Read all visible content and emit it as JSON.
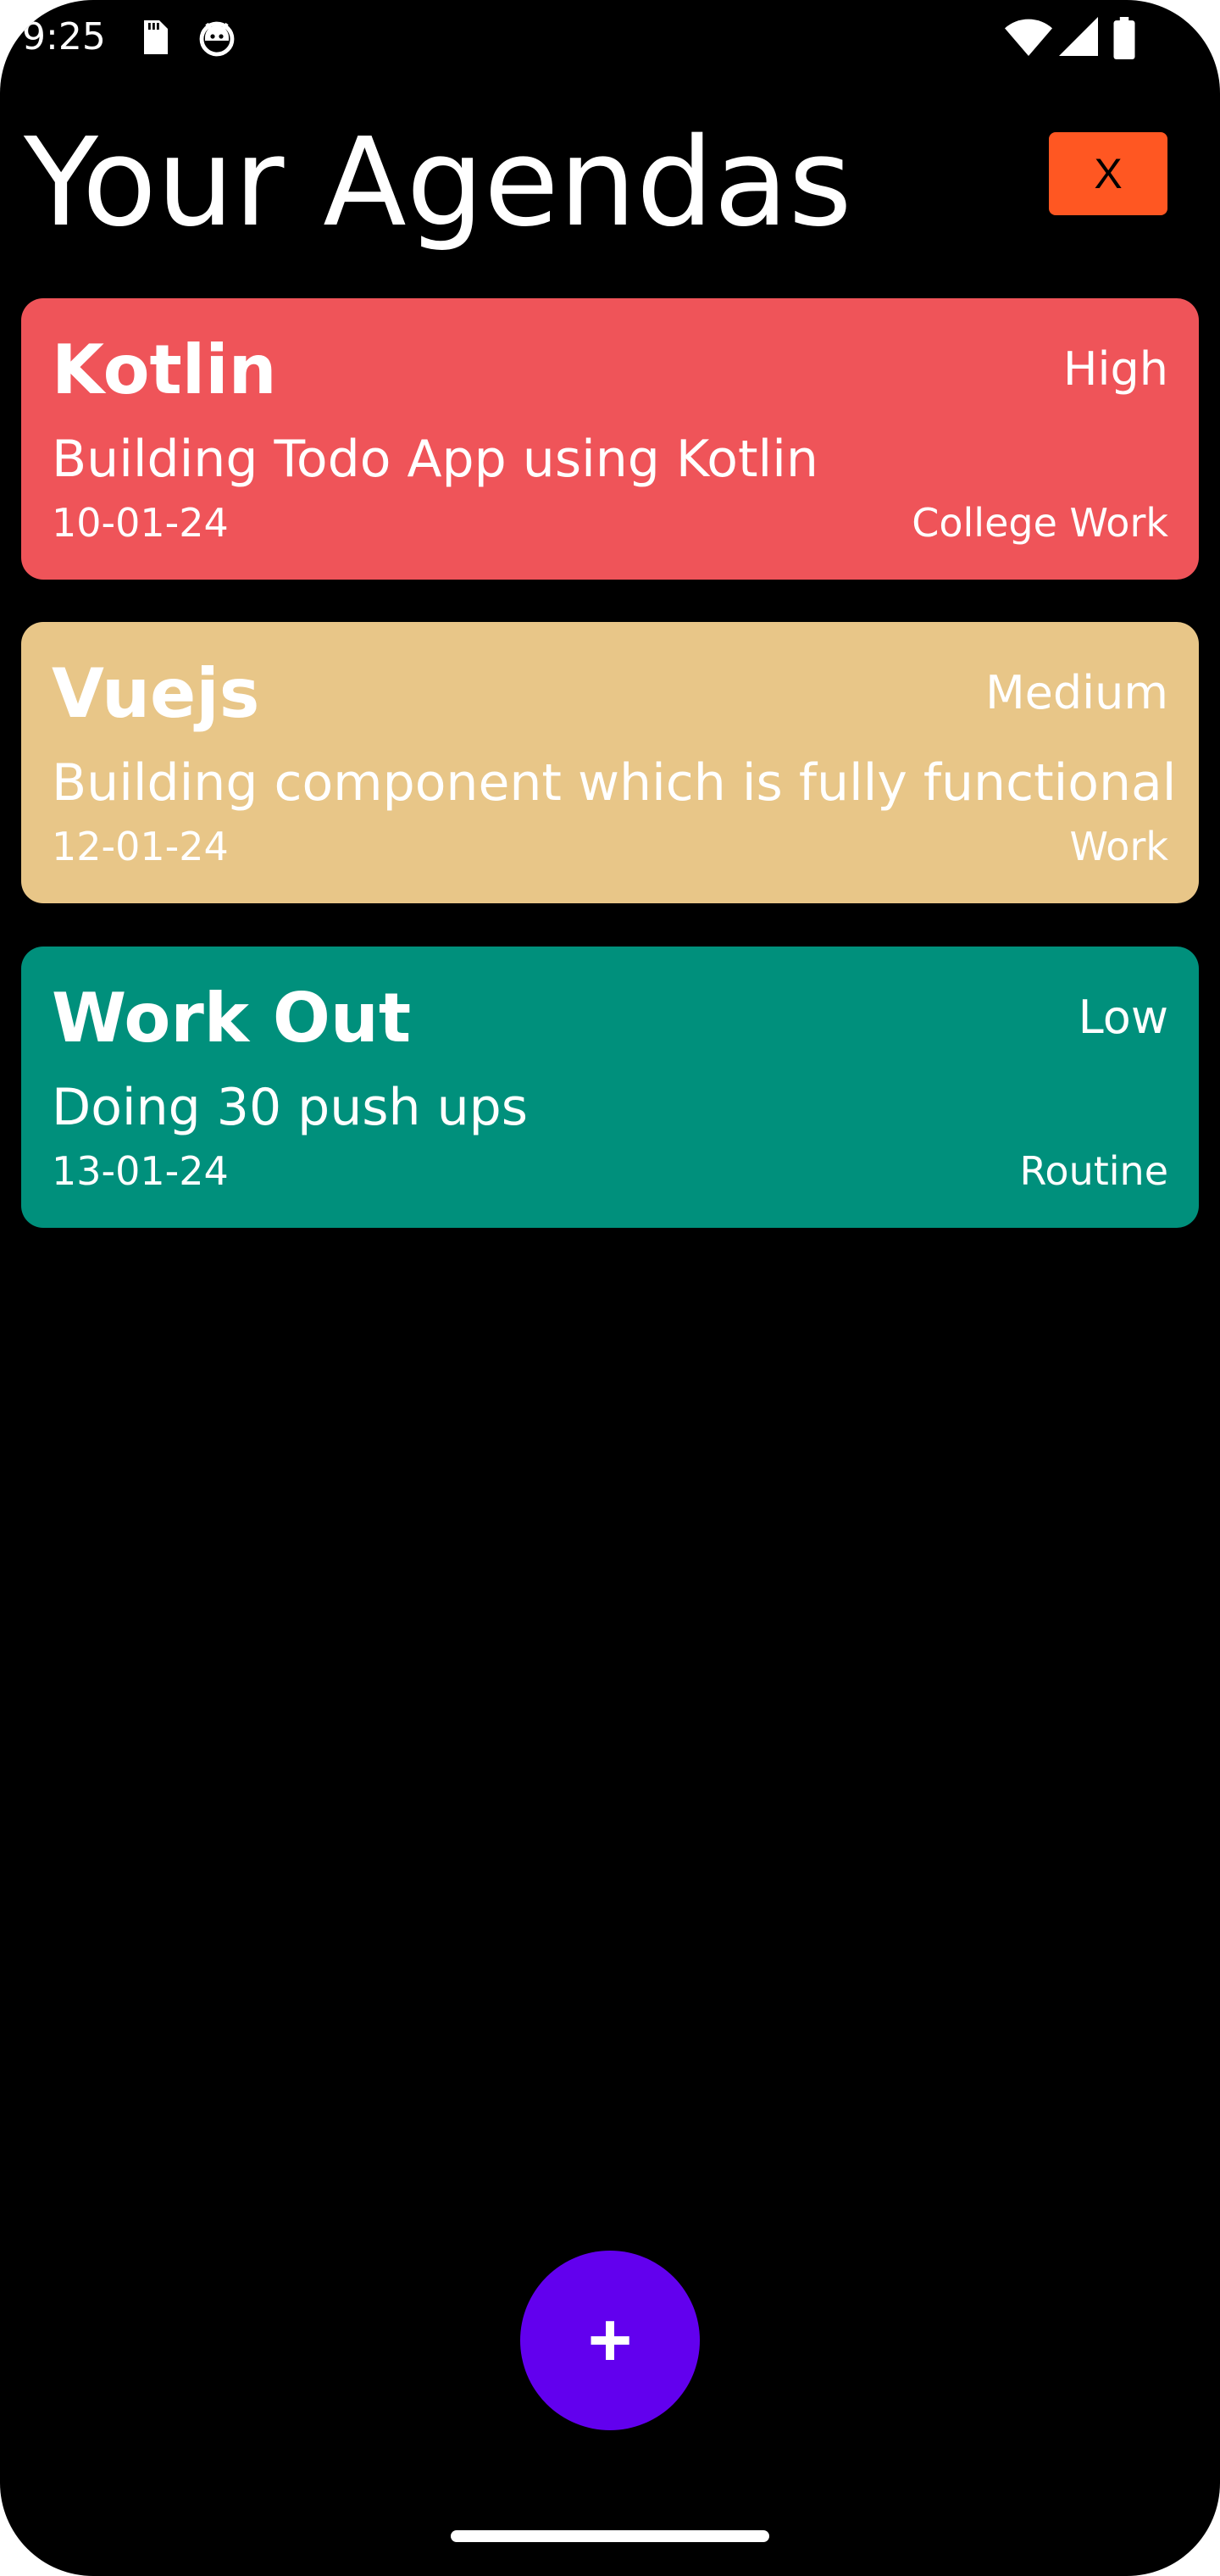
{
  "status_bar": {
    "time": "9:25",
    "icons": [
      "sd-card-icon",
      "android-debug-icon",
      "wifi-icon",
      "signal-icon",
      "battery-icon"
    ]
  },
  "header": {
    "title": "Your Agendas",
    "close_label": "X",
    "close_color": "#ff5722"
  },
  "agendas": [
    {
      "title": "Kotlin",
      "priority": "High",
      "description": "Building Todo App using Kotlin",
      "date": "10-01-24",
      "category": "College Work",
      "color": "#ef5459"
    },
    {
      "title": "Vuejs",
      "priority": "Medium",
      "description": "Building component which is fully functional",
      "date": "12-01-24",
      "category": "Work",
      "color": "#e8c688"
    },
    {
      "title": "Work Out",
      "priority": "Low",
      "description": "Doing 30 push ups",
      "date": "13-01-24",
      "category": "Routine",
      "color": "#00907c"
    }
  ],
  "fab": {
    "label": "+",
    "color": "#6200ee"
  }
}
